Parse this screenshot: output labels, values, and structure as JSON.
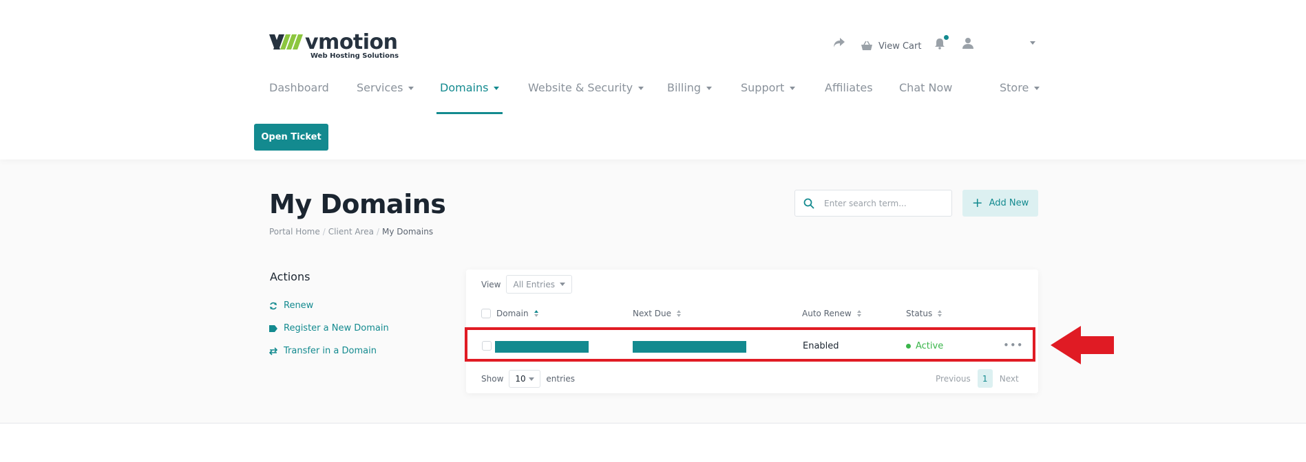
{
  "brand": {
    "name": "vmotion",
    "tagline": "Web Hosting Solutions",
    "accent": "#138a8f",
    "logo_green": "#8cc63f"
  },
  "top_actions": {
    "share_icon": "share-icon",
    "cart_label": "View Cart",
    "cart_icon": "basket-icon",
    "bell_icon": "bell-icon",
    "user_icon": "user-icon"
  },
  "nav": {
    "items": [
      {
        "label": "Dashboard",
        "dropdown": false
      },
      {
        "label": "Services",
        "dropdown": true
      },
      {
        "label": "Domains",
        "dropdown": true,
        "active": true
      },
      {
        "label": "Website & Security",
        "dropdown": true
      },
      {
        "label": "Billing",
        "dropdown": true
      },
      {
        "label": "Support",
        "dropdown": true
      },
      {
        "label": "Affiliates",
        "dropdown": false
      },
      {
        "label": "Chat Now",
        "dropdown": false
      },
      {
        "label": "Store",
        "dropdown": true
      }
    ]
  },
  "open_ticket_label": "Open Ticket",
  "page": {
    "title": "My Domains",
    "breadcrumb": [
      "Portal Home",
      "Client Area",
      "My Domains"
    ]
  },
  "search": {
    "placeholder": "Enter search term...",
    "icon": "search-icon"
  },
  "add_new_label": "Add New",
  "actions": {
    "heading": "Actions",
    "links": [
      {
        "label": "Renew",
        "icon": "refresh-icon"
      },
      {
        "label": "Register a New Domain",
        "icon": "tag-icon"
      },
      {
        "label": "Transfer in a Domain",
        "icon": "transfer-icon"
      }
    ]
  },
  "table": {
    "view_label": "View",
    "view_value": "All Entries",
    "columns": [
      "Domain",
      "Next Due",
      "Auto Renew",
      "Status"
    ],
    "rows": [
      {
        "domain": "",
        "next_due": "",
        "auto_renew": "Enabled",
        "status": "Active"
      }
    ],
    "show_label": "Show",
    "show_value": "10",
    "entries_label": "entries",
    "pagination": {
      "previous": "Previous",
      "current": "1",
      "next": "Next"
    }
  },
  "annotations": {
    "highlight_color": "#e01b24"
  }
}
